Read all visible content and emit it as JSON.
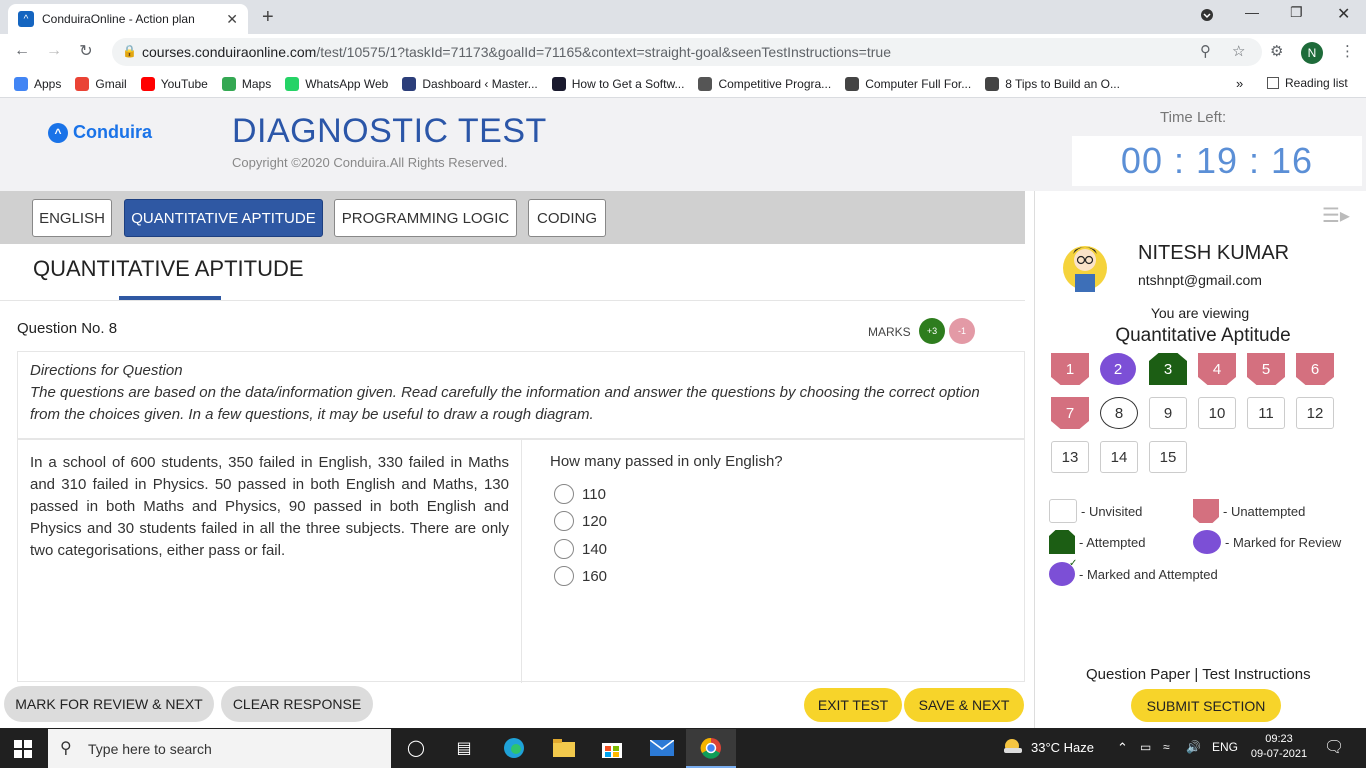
{
  "browser": {
    "tab_title": "ConduiraOnline - Action plan",
    "tab_close": "✕",
    "new_tab": "+",
    "url_host": "courses.conduiraonline.com",
    "url_path": "/test/10575/1?taskId=71173&goalId=71165&context=straight-goal&seenTestInstructions=true",
    "profile_initial": "N",
    "bookmarks": [
      {
        "label": "Apps",
        "color": "#4285f4"
      },
      {
        "label": "Gmail",
        "color": "#ea4335"
      },
      {
        "label": "YouTube",
        "color": "#ff0000"
      },
      {
        "label": "Maps",
        "color": "#34a853"
      },
      {
        "label": "WhatsApp Web",
        "color": "#25d366"
      },
      {
        "label": "Dashboard ‹ Master...",
        "color": "#2c3e7a"
      },
      {
        "label": "How to Get a Softw...",
        "color": "#1a1a2e"
      },
      {
        "label": "Competitive Progra...",
        "color": "#555555"
      },
      {
        "label": "Computer Full For...",
        "color": "#444444"
      },
      {
        "label": "8 Tips to Build an O...",
        "color": "#444444"
      }
    ],
    "bookmarks_more": "»",
    "reading_list": "Reading list"
  },
  "header": {
    "logo_text": "Conduira",
    "title": "DIAGNOSTIC TEST",
    "copyright": "Copyright ©2020 Conduira.All Rights Reserved.",
    "time_left_label": "Time Left:",
    "timer": "00 : 19 : 16"
  },
  "sections": [
    {
      "label": "ENGLISH",
      "active": false
    },
    {
      "label": "QUANTITATIVE APTITUDE",
      "active": true
    },
    {
      "label": "PROGRAMMING LOGIC",
      "active": false
    },
    {
      "label": "CODING",
      "active": false
    }
  ],
  "section_title": "QUANTITATIVE APTITUDE",
  "question": {
    "number_label": "Question No. 8",
    "marks_label": "MARKS",
    "marks_positive": "+3",
    "marks_negative": "-1",
    "directions_title": "Directions for Question",
    "directions_text": "The questions are based on the data/information given. Read carefully the information and answer the questions by choosing the correct option from the choices given. In a few questions, it may be useful to draw a rough diagram.",
    "passage": "In a school of 600 students, 350 failed in English, 330 failed in Maths and 310 failed in Physics. 50 passed in both English and Maths, 130 passed in both Maths and Physics, 90 passed in both English and Physics and 30 students failed in all the three subjects. There are only two categorisations, either pass or fail.",
    "prompt": "How many passed in only English?",
    "options": [
      "110",
      "120",
      "140",
      "160"
    ]
  },
  "actions": {
    "mark_review": "MARK FOR REVIEW & NEXT",
    "clear": "CLEAR RESPONSE",
    "exit": "EXIT TEST",
    "save_next": "SAVE & NEXT"
  },
  "user": {
    "name": "NITESH KUMAR",
    "email": "ntshnpt@gmail.com",
    "viewing_label": "You are viewing",
    "viewing_section": "Quantitative Aptitude"
  },
  "palette": [
    {
      "n": "1",
      "state": "unattempted"
    },
    {
      "n": "2",
      "state": "marked"
    },
    {
      "n": "3",
      "state": "attempted"
    },
    {
      "n": "4",
      "state": "unattempted"
    },
    {
      "n": "5",
      "state": "unattempted"
    },
    {
      "n": "6",
      "state": "unattempted"
    },
    {
      "n": "7",
      "state": "unattempted"
    },
    {
      "n": "8",
      "state": "current"
    },
    {
      "n": "9",
      "state": "unvisited"
    },
    {
      "n": "10",
      "state": "unvisited"
    },
    {
      "n": "11",
      "state": "unvisited"
    },
    {
      "n": "12",
      "state": "unvisited"
    },
    {
      "n": "13",
      "state": "unvisited"
    },
    {
      "n": "14",
      "state": "unvisited"
    },
    {
      "n": "15",
      "state": "unvisited"
    }
  ],
  "legend": {
    "unvisited": "- Unvisited",
    "unattempted": "- Unattempted",
    "attempted": "- Attempted",
    "marked": "- Marked for Review",
    "marked_attempted": "- Marked and Attempted"
  },
  "footer_links": {
    "question_paper": "Question Paper",
    "separator": "|",
    "instructions": "Test Instructions"
  },
  "submit_label": "SUBMIT SECTION",
  "taskbar": {
    "search_placeholder": "Type here to search",
    "weather": "33°C  Haze",
    "lang": "ENG",
    "time": "09:23",
    "date": "09-07-2021"
  },
  "colors": {
    "accent": "#2f58a3",
    "unattempted": "#d4707f",
    "attempted": "#1c5e14",
    "marked": "#7c4fd6",
    "button_yellow": "#f7d42a"
  }
}
